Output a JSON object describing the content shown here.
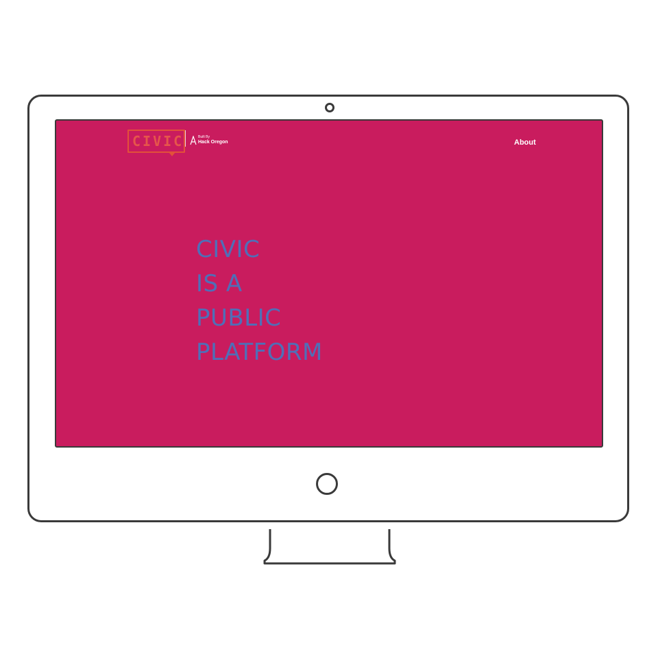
{
  "brand": {
    "logo_text": "CIVIC",
    "built_by": "Built By",
    "org_name": "Hack Oregon"
  },
  "nav": {
    "about_label": "About"
  },
  "hero": {
    "lines": [
      "CIVIC",
      "IS A",
      "PUBLIC",
      "PLATFORM"
    ]
  },
  "colors": {
    "screen_background": "#c91c5e",
    "logo": "#e2513a",
    "hero_text": "#4f6fb8",
    "frame": "#3a3a3a"
  }
}
